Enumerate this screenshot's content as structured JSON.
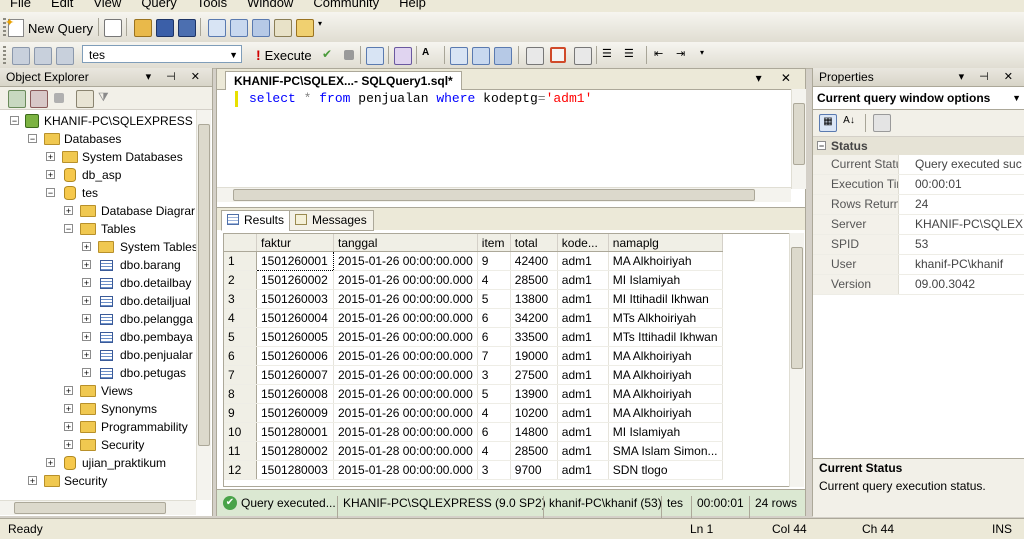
{
  "menu": [
    "File",
    "Edit",
    "View",
    "Query",
    "Tools",
    "Window",
    "Community",
    "Help"
  ],
  "toolbar": {
    "new_query": "New Query",
    "database": "tes",
    "execute": "Execute"
  },
  "object_explorer": {
    "title": "Object Explorer",
    "tree": [
      {
        "label": "KHANIF-PC\\SQLEXPRESS (S(",
        "kind": "server",
        "expander": "−"
      },
      {
        "label": "Databases",
        "kind": "folder",
        "expander": "−"
      },
      {
        "label": "System Databases",
        "kind": "folder",
        "expander": "+"
      },
      {
        "label": "db_asp",
        "kind": "db",
        "expander": "+"
      },
      {
        "label": "tes",
        "kind": "db",
        "expander": "−"
      },
      {
        "label": "Database Diagrar",
        "kind": "folder",
        "expander": "+"
      },
      {
        "label": "Tables",
        "kind": "folder",
        "expander": "−"
      },
      {
        "label": "System Tables",
        "kind": "folder",
        "expander": "+"
      },
      {
        "label": "dbo.barang",
        "kind": "table",
        "expander": "+"
      },
      {
        "label": "dbo.detailbay",
        "kind": "table",
        "expander": "+"
      },
      {
        "label": "dbo.detailjual",
        "kind": "table",
        "expander": "+"
      },
      {
        "label": "dbo.pelangga",
        "kind": "table",
        "expander": "+"
      },
      {
        "label": "dbo.pembaya",
        "kind": "table",
        "expander": "+"
      },
      {
        "label": "dbo.penjualar",
        "kind": "table",
        "expander": "+"
      },
      {
        "label": "dbo.petugas",
        "kind": "table",
        "expander": "+"
      },
      {
        "label": "Views",
        "kind": "folder",
        "expander": "+"
      },
      {
        "label": "Synonyms",
        "kind": "folder",
        "expander": "+"
      },
      {
        "label": "Programmability",
        "kind": "folder",
        "expander": "+"
      },
      {
        "label": "Security",
        "kind": "folder",
        "expander": "+"
      },
      {
        "label": "ujian_praktikum",
        "kind": "db",
        "expander": "+"
      },
      {
        "label": "Security",
        "kind": "folder",
        "expander": "+"
      }
    ]
  },
  "document": {
    "tab_title": "KHANIF-PC\\SQLEX...- SQLQuery1.sql*",
    "code": {
      "kw1": "select",
      "op1": "*",
      "kw2": "from",
      "t1": "penjualan",
      "kw3": "where",
      "t2": "kodeptg",
      "op2": "=",
      "str": "'adm1'"
    },
    "tabs": {
      "results": "Results",
      "messages": "Messages"
    },
    "grid": {
      "columns": [
        "faktur",
        "tanggal",
        "item",
        "total",
        "kode...",
        "namaplg"
      ],
      "rows": [
        [
          "1",
          "1501260001",
          "2015-01-26 00:00:00.000",
          "9",
          "42400",
          "adm1",
          "MA Alkhoiriyah"
        ],
        [
          "2",
          "1501260002",
          "2015-01-26 00:00:00.000",
          "4",
          "28500",
          "adm1",
          "MI Islamiyah"
        ],
        [
          "3",
          "1501260003",
          "2015-01-26 00:00:00.000",
          "5",
          "13800",
          "adm1",
          "MI Ittihadil Ikhwan"
        ],
        [
          "4",
          "1501260004",
          "2015-01-26 00:00:00.000",
          "6",
          "34200",
          "adm1",
          "MTs Alkhoiriyah"
        ],
        [
          "5",
          "1501260005",
          "2015-01-26 00:00:00.000",
          "6",
          "33500",
          "adm1",
          "MTs Ittihadil Ikhwan"
        ],
        [
          "6",
          "1501260006",
          "2015-01-26 00:00:00.000",
          "7",
          "19000",
          "adm1",
          "MA Alkhoiriyah"
        ],
        [
          "7",
          "1501260007",
          "2015-01-26 00:00:00.000",
          "3",
          "27500",
          "adm1",
          "MA Alkhoiriyah"
        ],
        [
          "8",
          "1501260008",
          "2015-01-26 00:00:00.000",
          "5",
          "13900",
          "adm1",
          "MA Alkhoiriyah"
        ],
        [
          "9",
          "1501260009",
          "2015-01-26 00:00:00.000",
          "4",
          "10200",
          "adm1",
          "MA Alkhoiriyah"
        ],
        [
          "10",
          "1501280001",
          "2015-01-28 00:00:00.000",
          "6",
          "14800",
          "adm1",
          "MI Islamiyah"
        ],
        [
          "11",
          "1501280002",
          "2015-01-28 00:00:00.000",
          "4",
          "28500",
          "adm1",
          "SMA Islam Simon..."
        ],
        [
          "12",
          "1501280003",
          "2015-01-28 00:00:00.000",
          "3",
          "9700",
          "adm1",
          "SDN tlogo"
        ]
      ]
    },
    "status": {
      "message": "Query executed...",
      "server": "KHANIF-PC\\SQLEXPRESS (9.0 SP2)",
      "user": "khanif-PC\\khanif (53)",
      "db": "tes",
      "time": "00:00:01",
      "rows": "24 rows"
    }
  },
  "properties": {
    "title": "Properties",
    "selector": "Current query window options",
    "group": "Status",
    "rows": [
      {
        "k": "Current Status",
        "v": "Query executed suc"
      },
      {
        "k": "Execution Time",
        "v": "00:00:01"
      },
      {
        "k": "Rows Returned",
        "v": "24"
      },
      {
        "k": "Server",
        "v": "KHANIF-PC\\SQLEXF"
      },
      {
        "k": "SPID",
        "v": "53"
      },
      {
        "k": "User",
        "v": "khanif-PC\\khanif"
      },
      {
        "k": "Version",
        "v": "09.00.3042"
      }
    ],
    "desc_title": "Current Status",
    "desc_text": "Current query execution status."
  },
  "statusbar": {
    "ready": "Ready",
    "ln": "Ln 1",
    "col": "Col 44",
    "ch": "Ch 44",
    "ins": "INS"
  }
}
